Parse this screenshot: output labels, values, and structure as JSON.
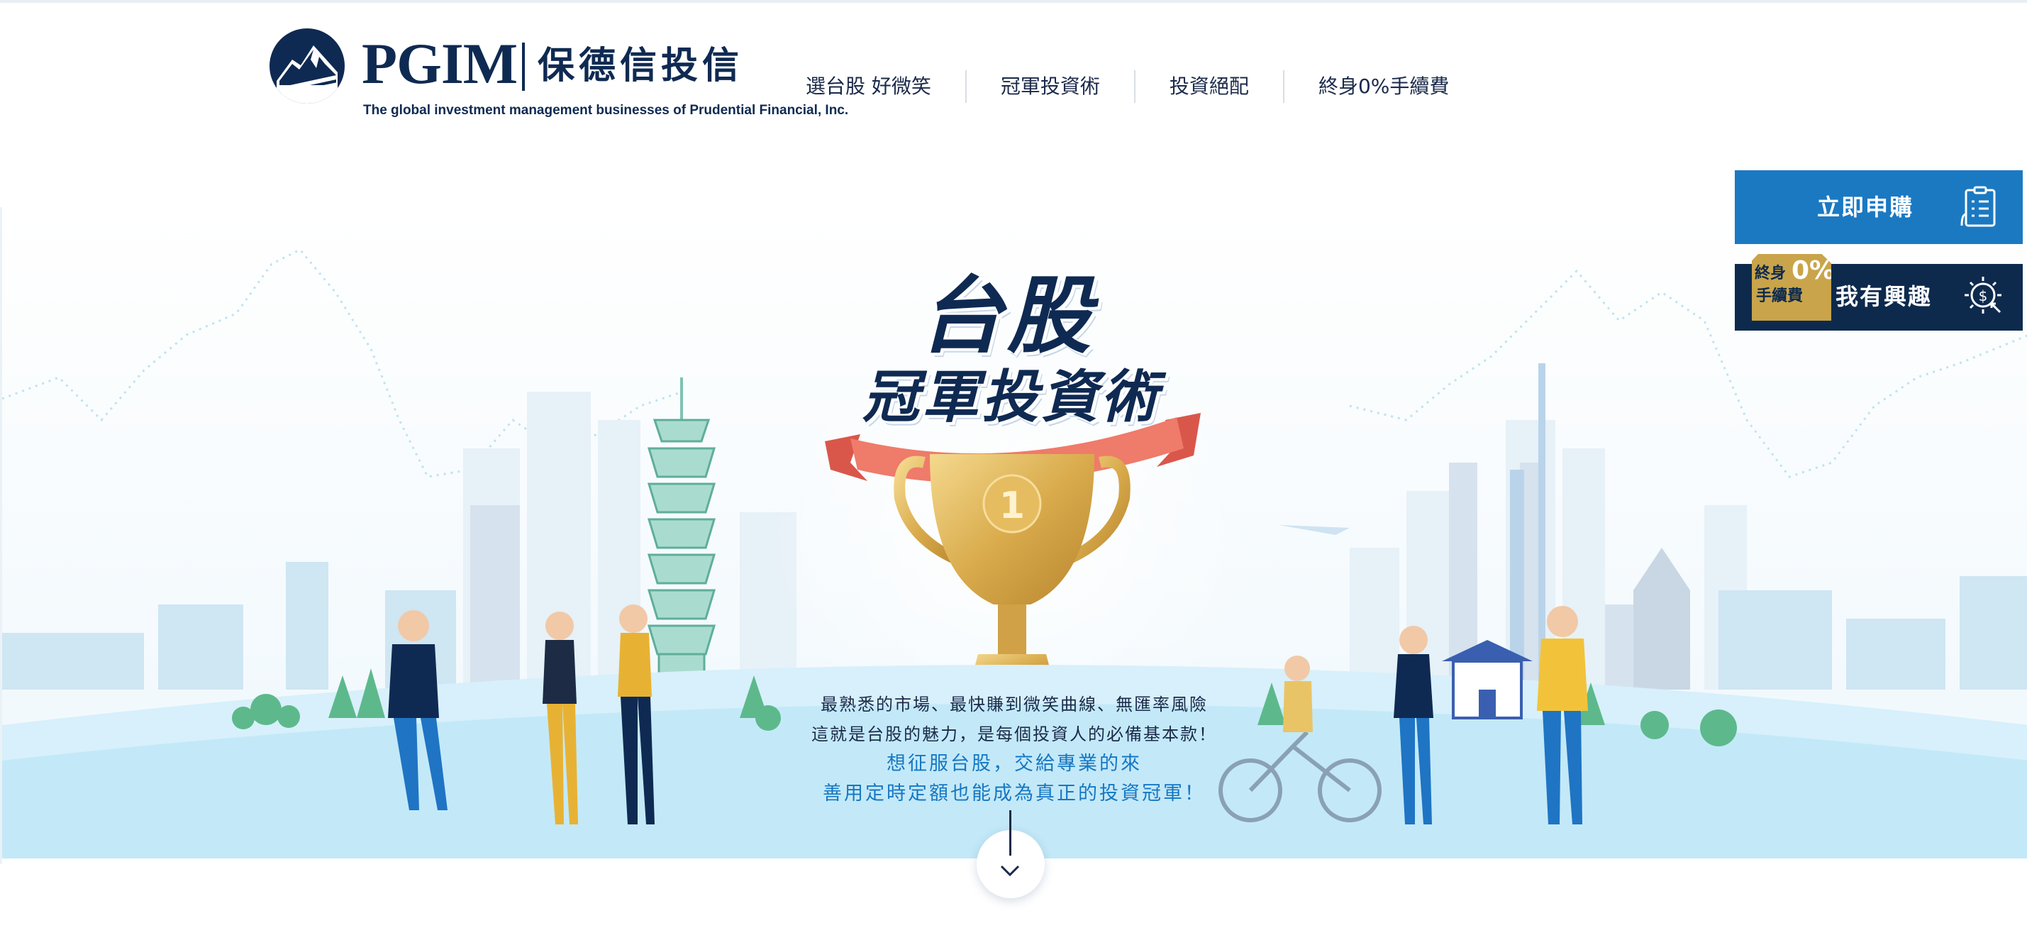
{
  "header": {
    "logo_word": "PGIM",
    "logo_cn": "保德信投信",
    "logo_tagline": "The global investment management businesses of Prudential Financial, Inc.",
    "nav": [
      {
        "label": "選台股 好微笑"
      },
      {
        "label": "冠軍投資術"
      },
      {
        "label": "投資絕配"
      },
      {
        "label": "終身0%手續費"
      }
    ]
  },
  "hero": {
    "title_main": "台股",
    "title_sub": "冠軍投資術",
    "trophy_rank": "1",
    "copy_lines": [
      "最熟悉的市場、最快賺到微笑曲線、無匯率風險",
      "這就是台股的魅力，是每個投資人的必備基本款！"
    ],
    "accent_lines": [
      "想征服台股，交給專業的來",
      "善用定時定額也能成為真正的投資冠軍！"
    ]
  },
  "cta": {
    "apply_label": "立即申購",
    "interest_label": "我有興趣",
    "badge_top": "終身",
    "badge_pct": "0%",
    "badge_bottom": "手續費"
  },
  "icons": {
    "apply": "form-list-icon",
    "interest": "dollar-coin-cursor-icon",
    "scroll": "chevron-down-icon",
    "logo": "rock-emblem-icon"
  },
  "colors": {
    "brand_navy": "#0f2a52",
    "accent_blue": "#1b79c2",
    "dark_panel": "#0d2a4d",
    "gold": "#c9a44a",
    "ribbon": "#ef7b6a"
  }
}
